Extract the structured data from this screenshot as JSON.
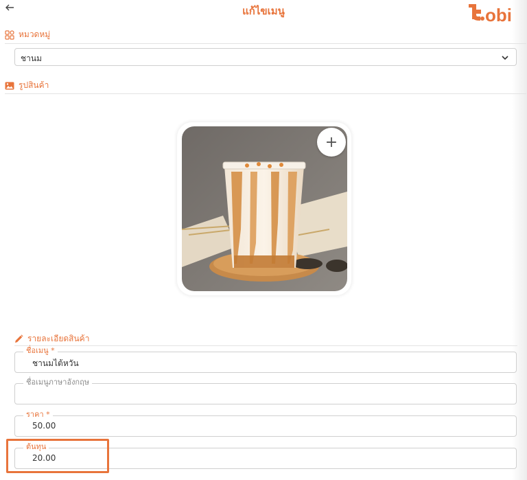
{
  "header": {
    "back_icon": "arrow-left-icon",
    "title": "แก้ไขเมนู",
    "logo_text": "tobi",
    "brand_color": "#e8743b"
  },
  "category_section": {
    "heading": "หมวดหมู่",
    "icon": "grid-icon",
    "selected_value": "ชานม",
    "dropdown_icon": "chevron-down-icon"
  },
  "image_section": {
    "heading": "รูปสินค้า",
    "icon": "image-icon",
    "add_button_label": "+"
  },
  "details_section": {
    "heading": "รายละเอียดสินค้า",
    "icon": "pencil-icon"
  },
  "fields": {
    "name_label": "ชื่อเมนู *",
    "name_value": "ชานมไต้หวัน",
    "english_name_label": "ชื่อเมนูภาษาอังกฤษ",
    "english_name_value": "",
    "price_label": "ราคา *",
    "price_value": "50.00",
    "cost_label": "ต้นทุน",
    "cost_value": "20.00"
  }
}
